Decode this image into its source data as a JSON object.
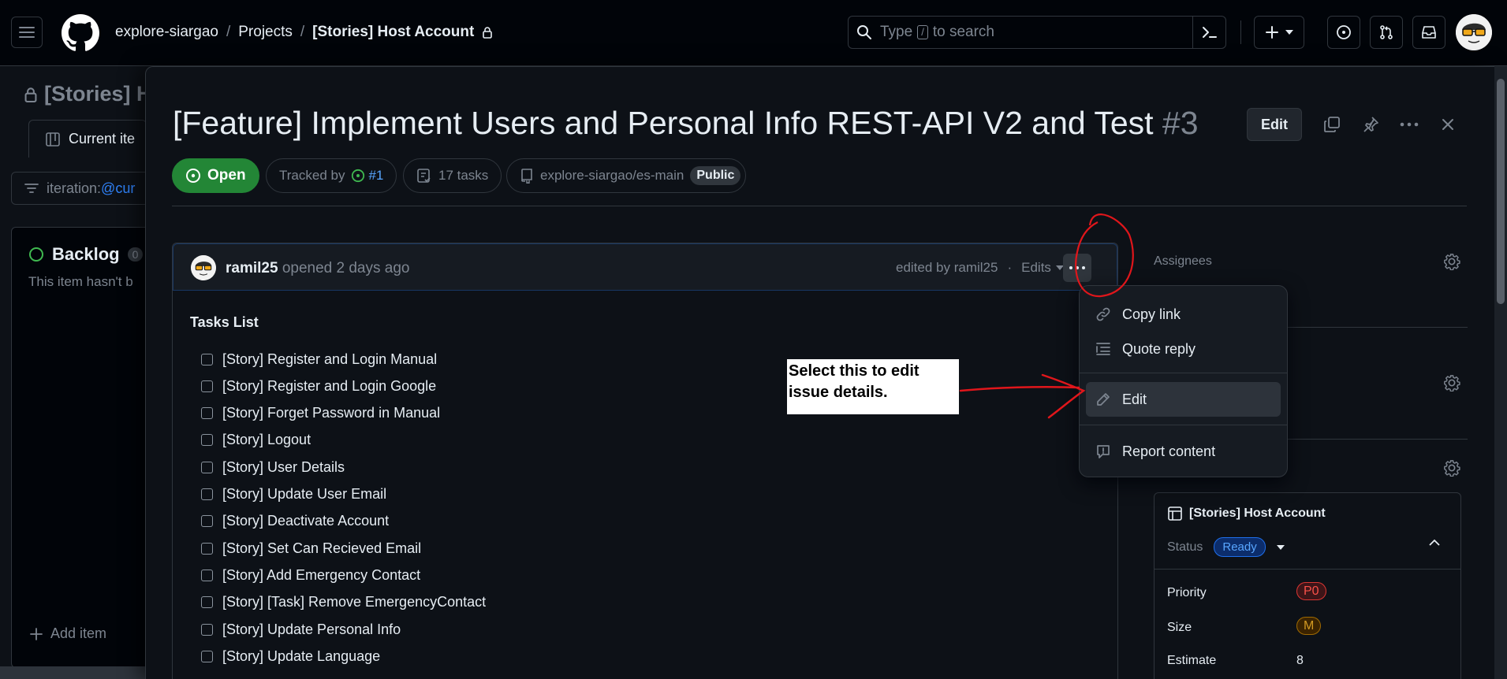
{
  "header": {
    "org": "explore-siargao",
    "sep1": "/",
    "projects": "Projects",
    "sep2": "/",
    "project_name": "[Stories] Host Account",
    "search_placeholder_pre": "Type",
    "search_key": "/",
    "search_placeholder_post": "to search"
  },
  "background": {
    "title": "[Stories] H",
    "tab": "Current ite",
    "filter_pre": "iteration:",
    "filter_val": "@cur",
    "column_title": "Backlog",
    "column_count": "0",
    "column_empty": "This item hasn't b",
    "add_item": "Add item"
  },
  "issue": {
    "title": "[Feature] Implement Users and Personal Info REST-API V2 and Test",
    "number": "#3",
    "edit_label": "Edit",
    "state": "Open",
    "tracked_by": "Tracked by",
    "tracked_ref": "#1",
    "tasks_count": "17 tasks",
    "repo": "explore-siargao/es-main",
    "visibility": "Public"
  },
  "comment": {
    "author": "ramil25",
    "opened": "opened 2 days ago",
    "edited_by": "edited by ramil25",
    "dot": "·",
    "edits": "Edits",
    "tasks_heading": "Tasks List",
    "tasks": [
      "[Story] Register and Login Manual",
      "[Story] Register and Login Google",
      "[Story] Forget Password in Manual",
      "[Story] Logout",
      "[Story] User Details",
      "[Story] Update User Email",
      "[Story] Deactivate Account",
      "[Story] Set Can Recieved Email",
      "[Story] Add Emergency Contact",
      "[Story] [Task] Remove EmergencyContact",
      "[Story] Update Personal Info",
      "[Story] Update Language"
    ]
  },
  "menu": {
    "copy_link": "Copy link",
    "quote_reply": "Quote reply",
    "edit": "Edit",
    "report": "Report content"
  },
  "sidebar": {
    "assignees": "Assignees",
    "project_name": "[Stories] Host Account",
    "status_label": "Status",
    "status_value": "Ready",
    "priority_label": "Priority",
    "priority_value": "P0",
    "size_label": "Size",
    "size_value": "M",
    "estimate_label": "Estimate",
    "estimate_value": "8"
  },
  "annotation": {
    "note_line1": "Select this to edit",
    "note_line2": "issue details."
  },
  "colors": {
    "accent": "#2f81f7",
    "open_green": "#238636",
    "annotation_red": "#e0161b"
  }
}
